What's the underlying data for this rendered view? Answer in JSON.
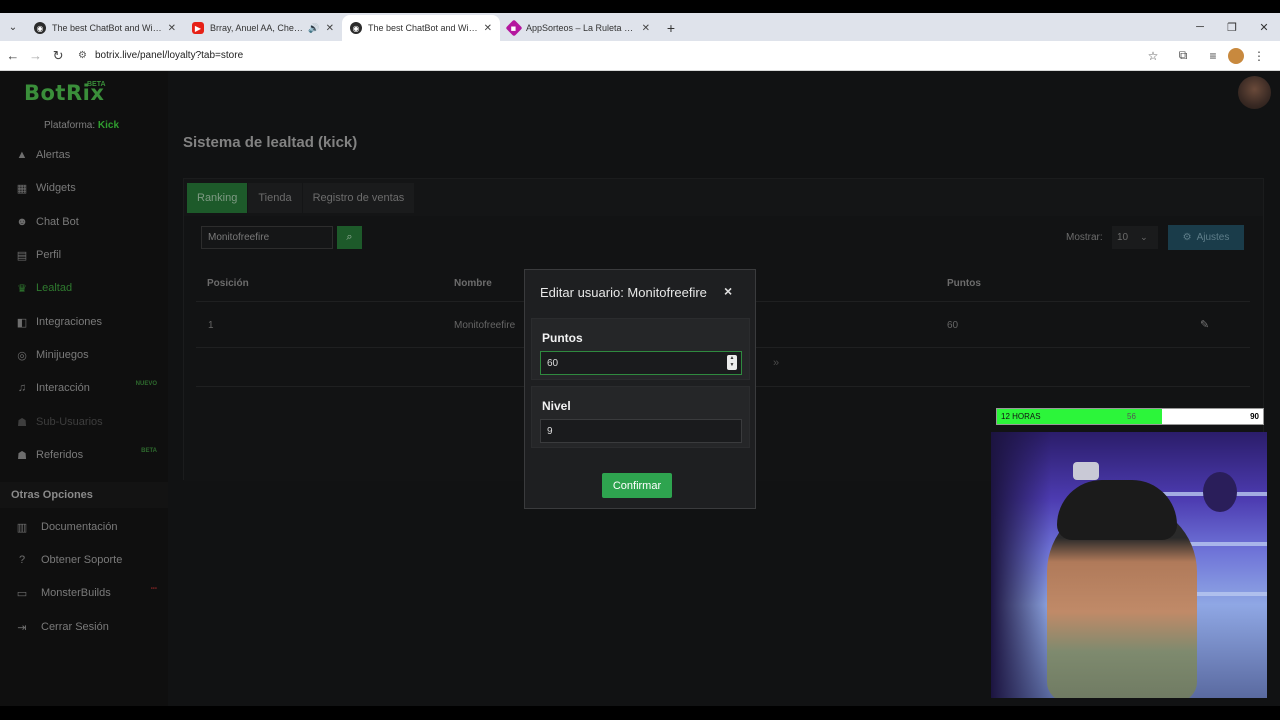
{
  "browser": {
    "tabs": [
      {
        "title": "The best ChatBot and Widgets",
        "active": false,
        "favicon_color": "#2b2b2b"
      },
      {
        "title": "Brray, Anuel AA, Chencho C",
        "active": false,
        "favicon_color": "#e62117"
      },
      {
        "title": "The best ChatBot and Widgets",
        "active": true,
        "favicon_color": "#2b2b2b"
      },
      {
        "title": "AppSorteos – La Ruleta de la S",
        "active": false,
        "favicon_color": "#b5179e"
      }
    ],
    "url": "botrix.live/panel/loyalty?tab=store"
  },
  "app": {
    "logo": "BotRix",
    "logo_badge": "BETA",
    "platform_label": "Plataforma:",
    "platform_value": "Kick",
    "nav": [
      {
        "label": "Alertas",
        "icon": "warning-icon",
        "state": "normal",
        "badge": ""
      },
      {
        "label": "Widgets",
        "icon": "grid-icon",
        "state": "normal",
        "badge": ""
      },
      {
        "label": "Chat Bot",
        "icon": "robot-icon",
        "state": "normal",
        "badge": ""
      },
      {
        "label": "Perfil",
        "icon": "id-card-icon",
        "state": "normal",
        "badge": ""
      },
      {
        "label": "Lealtad",
        "icon": "trophy-icon",
        "state": "active",
        "badge": ""
      },
      {
        "label": "Integraciones",
        "icon": "plug-icon",
        "state": "normal",
        "badge": ""
      },
      {
        "label": "Minijuegos",
        "icon": "gamepad-icon",
        "state": "normal",
        "badge": ""
      },
      {
        "label": "Interacción",
        "icon": "music-icon",
        "state": "normal",
        "badge": "NUEVO"
      },
      {
        "label": "Sub-Usuarios",
        "icon": "users-icon",
        "state": "disabled",
        "badge": ""
      },
      {
        "label": "Referidos",
        "icon": "users-icon",
        "state": "normal",
        "badge": "BETA"
      }
    ],
    "other_title": "Otras Opciones",
    "other": [
      {
        "label": "Documentación",
        "icon": "book-icon"
      },
      {
        "label": "Obtener Soporte",
        "icon": "question-icon"
      },
      {
        "label": "MonsterBuilds",
        "icon": "monitor-icon"
      },
      {
        "label": "Cerrar Sesión",
        "icon": "logout-icon"
      }
    ],
    "page_title": "Sistema de lealtad (kick)",
    "tabs": [
      "Ranking",
      "Tienda",
      "Registro de ventas"
    ],
    "search_value": "Monitofreefire",
    "show_label": "Mostrar:",
    "show_value": "10",
    "settings_label": "Ajustes",
    "columns": [
      "Posición",
      "Nombre",
      "Puntos"
    ],
    "rows": [
      {
        "position": "1",
        "name": "Monitofreefire",
        "points": "60"
      }
    ],
    "pager_next": "»"
  },
  "modal": {
    "title": "Editar usuario: Monitofreefire",
    "close": "×",
    "points_label": "Puntos",
    "points_value": "60",
    "level_label": "Nivel",
    "level_value": "9",
    "confirm_label": "Confirmar"
  },
  "overlay": {
    "timer_label": "12 HORAS",
    "timer_current": "56",
    "timer_max": "90",
    "timer_fraction": 0.622
  },
  "colors": {
    "accent_green": "#2ea44f",
    "timer_green": "#2cf53a"
  }
}
